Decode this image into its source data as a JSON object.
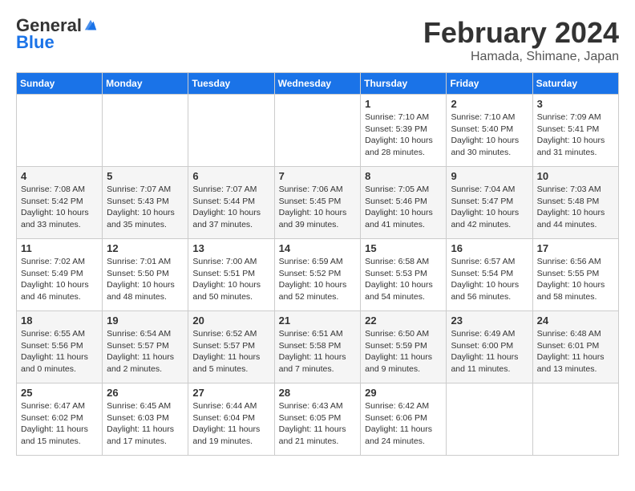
{
  "header": {
    "logo_line1": "General",
    "logo_line2": "Blue",
    "month_year": "February 2024",
    "location": "Hamada, Shimane, Japan"
  },
  "weekdays": [
    "Sunday",
    "Monday",
    "Tuesday",
    "Wednesday",
    "Thursday",
    "Friday",
    "Saturday"
  ],
  "weeks": [
    [
      {
        "day": "",
        "info": ""
      },
      {
        "day": "",
        "info": ""
      },
      {
        "day": "",
        "info": ""
      },
      {
        "day": "",
        "info": ""
      },
      {
        "day": "1",
        "info": "Sunrise: 7:10 AM\nSunset: 5:39 PM\nDaylight: 10 hours and 28 minutes."
      },
      {
        "day": "2",
        "info": "Sunrise: 7:10 AM\nSunset: 5:40 PM\nDaylight: 10 hours and 30 minutes."
      },
      {
        "day": "3",
        "info": "Sunrise: 7:09 AM\nSunset: 5:41 PM\nDaylight: 10 hours and 31 minutes."
      }
    ],
    [
      {
        "day": "4",
        "info": "Sunrise: 7:08 AM\nSunset: 5:42 PM\nDaylight: 10 hours and 33 minutes."
      },
      {
        "day": "5",
        "info": "Sunrise: 7:07 AM\nSunset: 5:43 PM\nDaylight: 10 hours and 35 minutes."
      },
      {
        "day": "6",
        "info": "Sunrise: 7:07 AM\nSunset: 5:44 PM\nDaylight: 10 hours and 37 minutes."
      },
      {
        "day": "7",
        "info": "Sunrise: 7:06 AM\nSunset: 5:45 PM\nDaylight: 10 hours and 39 minutes."
      },
      {
        "day": "8",
        "info": "Sunrise: 7:05 AM\nSunset: 5:46 PM\nDaylight: 10 hours and 41 minutes."
      },
      {
        "day": "9",
        "info": "Sunrise: 7:04 AM\nSunset: 5:47 PM\nDaylight: 10 hours and 42 minutes."
      },
      {
        "day": "10",
        "info": "Sunrise: 7:03 AM\nSunset: 5:48 PM\nDaylight: 10 hours and 44 minutes."
      }
    ],
    [
      {
        "day": "11",
        "info": "Sunrise: 7:02 AM\nSunset: 5:49 PM\nDaylight: 10 hours and 46 minutes."
      },
      {
        "day": "12",
        "info": "Sunrise: 7:01 AM\nSunset: 5:50 PM\nDaylight: 10 hours and 48 minutes."
      },
      {
        "day": "13",
        "info": "Sunrise: 7:00 AM\nSunset: 5:51 PM\nDaylight: 10 hours and 50 minutes."
      },
      {
        "day": "14",
        "info": "Sunrise: 6:59 AM\nSunset: 5:52 PM\nDaylight: 10 hours and 52 minutes."
      },
      {
        "day": "15",
        "info": "Sunrise: 6:58 AM\nSunset: 5:53 PM\nDaylight: 10 hours and 54 minutes."
      },
      {
        "day": "16",
        "info": "Sunrise: 6:57 AM\nSunset: 5:54 PM\nDaylight: 10 hours and 56 minutes."
      },
      {
        "day": "17",
        "info": "Sunrise: 6:56 AM\nSunset: 5:55 PM\nDaylight: 10 hours and 58 minutes."
      }
    ],
    [
      {
        "day": "18",
        "info": "Sunrise: 6:55 AM\nSunset: 5:56 PM\nDaylight: 11 hours and 0 minutes."
      },
      {
        "day": "19",
        "info": "Sunrise: 6:54 AM\nSunset: 5:57 PM\nDaylight: 11 hours and 2 minutes."
      },
      {
        "day": "20",
        "info": "Sunrise: 6:52 AM\nSunset: 5:57 PM\nDaylight: 11 hours and 5 minutes."
      },
      {
        "day": "21",
        "info": "Sunrise: 6:51 AM\nSunset: 5:58 PM\nDaylight: 11 hours and 7 minutes."
      },
      {
        "day": "22",
        "info": "Sunrise: 6:50 AM\nSunset: 5:59 PM\nDaylight: 11 hours and 9 minutes."
      },
      {
        "day": "23",
        "info": "Sunrise: 6:49 AM\nSunset: 6:00 PM\nDaylight: 11 hours and 11 minutes."
      },
      {
        "day": "24",
        "info": "Sunrise: 6:48 AM\nSunset: 6:01 PM\nDaylight: 11 hours and 13 minutes."
      }
    ],
    [
      {
        "day": "25",
        "info": "Sunrise: 6:47 AM\nSunset: 6:02 PM\nDaylight: 11 hours and 15 minutes."
      },
      {
        "day": "26",
        "info": "Sunrise: 6:45 AM\nSunset: 6:03 PM\nDaylight: 11 hours and 17 minutes."
      },
      {
        "day": "27",
        "info": "Sunrise: 6:44 AM\nSunset: 6:04 PM\nDaylight: 11 hours and 19 minutes."
      },
      {
        "day": "28",
        "info": "Sunrise: 6:43 AM\nSunset: 6:05 PM\nDaylight: 11 hours and 21 minutes."
      },
      {
        "day": "29",
        "info": "Sunrise: 6:42 AM\nSunset: 6:06 PM\nDaylight: 11 hours and 24 minutes."
      },
      {
        "day": "",
        "info": ""
      },
      {
        "day": "",
        "info": ""
      }
    ]
  ]
}
